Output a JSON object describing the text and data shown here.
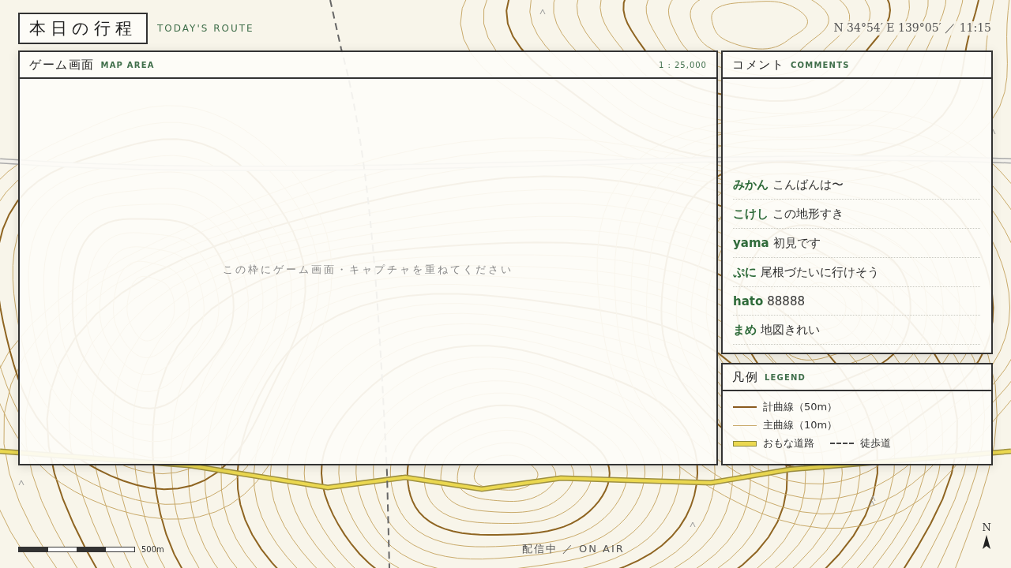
{
  "header": {
    "title": "本日の行程",
    "subtitle": "TODAY'S ROUTE",
    "location_time": "N 34°54′ E 139°05′ ／ 11:15"
  },
  "map_panel": {
    "title": "ゲーム画面",
    "subtitle": "MAP AREA",
    "scale": "1 : 25,000",
    "hint": "この枠にゲーム画面・キャプチャを重ねてください"
  },
  "comments_panel": {
    "title": "コメント",
    "subtitle": "COMMENTS",
    "comments": [
      {
        "user": "みかん",
        "text": "こんばんは〜"
      },
      {
        "user": "こけし",
        "text": "この地形すき"
      },
      {
        "user": "yama",
        "text": "初見です"
      },
      {
        "user": "ぷに",
        "text": "尾根づたいに行けそう"
      },
      {
        "user": "hato",
        "text": "88888"
      },
      {
        "user": "まめ",
        "text": "地図きれい"
      }
    ]
  },
  "legend_panel": {
    "title": "凡例",
    "subtitle": "LEGEND",
    "rows": [
      [
        {
          "kind": "index_contour",
          "label": "計曲線（50m）"
        }
      ],
      [
        {
          "kind": "intermediate_contour",
          "label": "主曲線（10m）"
        }
      ],
      [
        {
          "kind": "road",
          "label": "おもな道路"
        },
        {
          "kind": "trail",
          "label": "徒歩道"
        }
      ]
    ]
  },
  "footer": {
    "scale_label": "500m",
    "status": "配信中 ／ ON AIR",
    "north_label": "N"
  }
}
